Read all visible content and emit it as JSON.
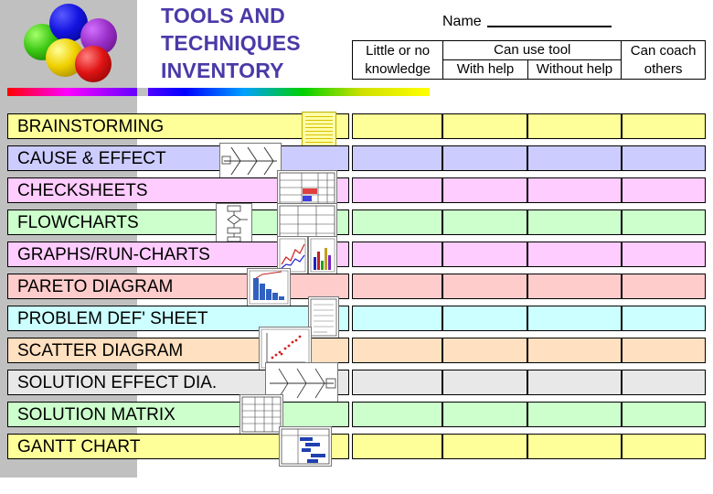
{
  "document": {
    "title_lines": [
      "TOOLS AND",
      "TECHNIQUES",
      "INVENTORY"
    ],
    "name_label": "Name",
    "header": {
      "col1": "Little or no knowledge",
      "col1_line1": "Little or no",
      "col1_line2": "knowledge",
      "group_can_use_tool": "Can use tool",
      "col2": "With help",
      "col3": "Without help",
      "col4_line1": "Can coach",
      "col4_line2": "others"
    },
    "rows": [
      {
        "label": "BRAINSTORMING",
        "row_color": "#ffff99",
        "thumb": "sticky-note"
      },
      {
        "label": "CAUSE & EFFECT",
        "row_color": "#ccccff",
        "thumb": "fishbone-diagram"
      },
      {
        "label": "CHECKSHEETS",
        "row_color": "#ffccff",
        "thumb": "checksheet-table"
      },
      {
        "label": "FLOWCHARTS",
        "row_color": "#ccffcc",
        "thumb": "flowchart"
      },
      {
        "label": "GRAPHS/RUN-CHARTS",
        "row_color": "#ffccff",
        "thumb": "bar-graph"
      },
      {
        "label": "PARETO DIAGRAM",
        "row_color": "#ffcccc",
        "thumb": "pareto-chart"
      },
      {
        "label": "PROBLEM DEF' SHEET",
        "row_color": "#ccffff",
        "thumb": "problem-sheet"
      },
      {
        "label": "SCATTER DIAGRAM",
        "row_color": "#ffe0c0",
        "thumb": "scatter-plot"
      },
      {
        "label": "SOLUTION EFFECT DIA.",
        "row_color": "#e8e8e8",
        "thumb": "solution-effect-diagram"
      },
      {
        "label": "SOLUTION MATRIX",
        "row_color": "#ccffcc",
        "thumb": "matrix-table"
      },
      {
        "label": "GANTT CHART",
        "row_color": "#ffff99",
        "thumb": "gantt-chart"
      }
    ],
    "colors": {
      "title": "#4a3aa8",
      "band": "#c0c0c0",
      "border": "#000000"
    }
  }
}
